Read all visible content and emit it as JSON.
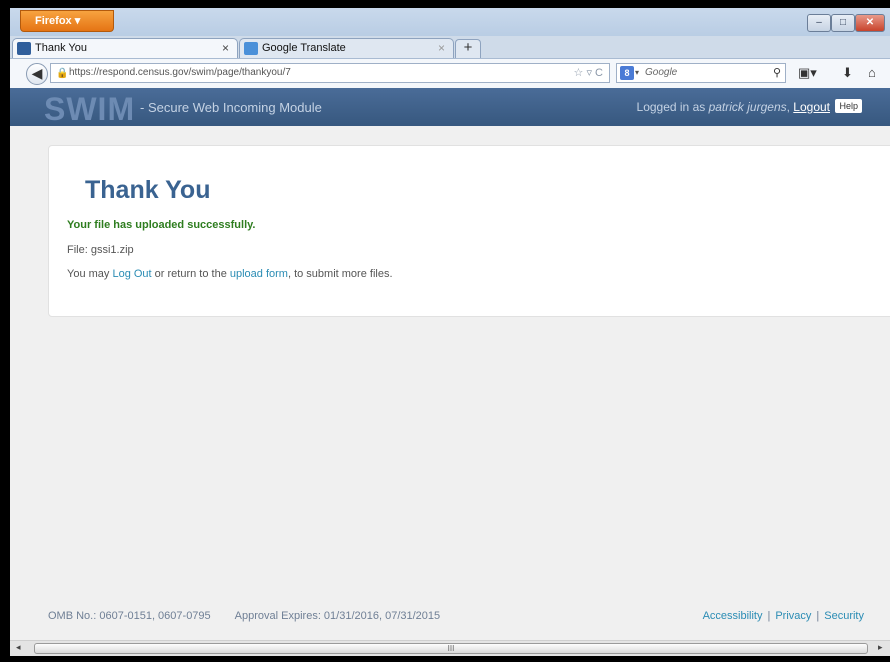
{
  "browser": {
    "menu_label": "Firefox ▾",
    "window_controls": {
      "minimize": "–",
      "maximize": "□",
      "close": "✕"
    },
    "tabs": [
      {
        "title": "Thank You",
        "close": "×"
      },
      {
        "title": "Google Translate",
        "close": "×"
      }
    ],
    "new_tab": "+",
    "url": "https://respond.census.gov/swim/page/thankyou/7",
    "url_icons": "☆ ▿ C",
    "search_placeholder": "Google",
    "search_engine_badge": "8",
    "search_arrow": "▾",
    "search_mag": "⚲",
    "back_glyph": "◀",
    "lock_glyph": "🔒",
    "nav_icons": {
      "bookmarks": "▣▾",
      "downloads": "⬇",
      "home": "⌂"
    }
  },
  "header": {
    "logo": "SWIM",
    "subtitle": "- Secure Web Incoming Module",
    "logged_in_prefix": "Logged in as ",
    "user": "patrick jurgens",
    "logout": "Logout",
    "help": "Help"
  },
  "content": {
    "title": "Thank You",
    "success_message": "Your file has uploaded successfully.",
    "file_label": "File: gssi1.zip",
    "may_prefix": "You may ",
    "logout_link": "Log Out",
    "middle_text": " or return to the ",
    "upload_link": "upload form",
    "suffix_text": ", to submit more files."
  },
  "footer": {
    "omb": "OMB No.: 0607-0151, 0607-0795",
    "approval": "Approval Expires: 01/31/2016, 07/31/2015",
    "links": [
      "Accessibility",
      "Privacy",
      "Security"
    ],
    "separator": "|"
  },
  "scrollbar": {
    "grip": "III",
    "left": "◂",
    "right": "▸"
  }
}
